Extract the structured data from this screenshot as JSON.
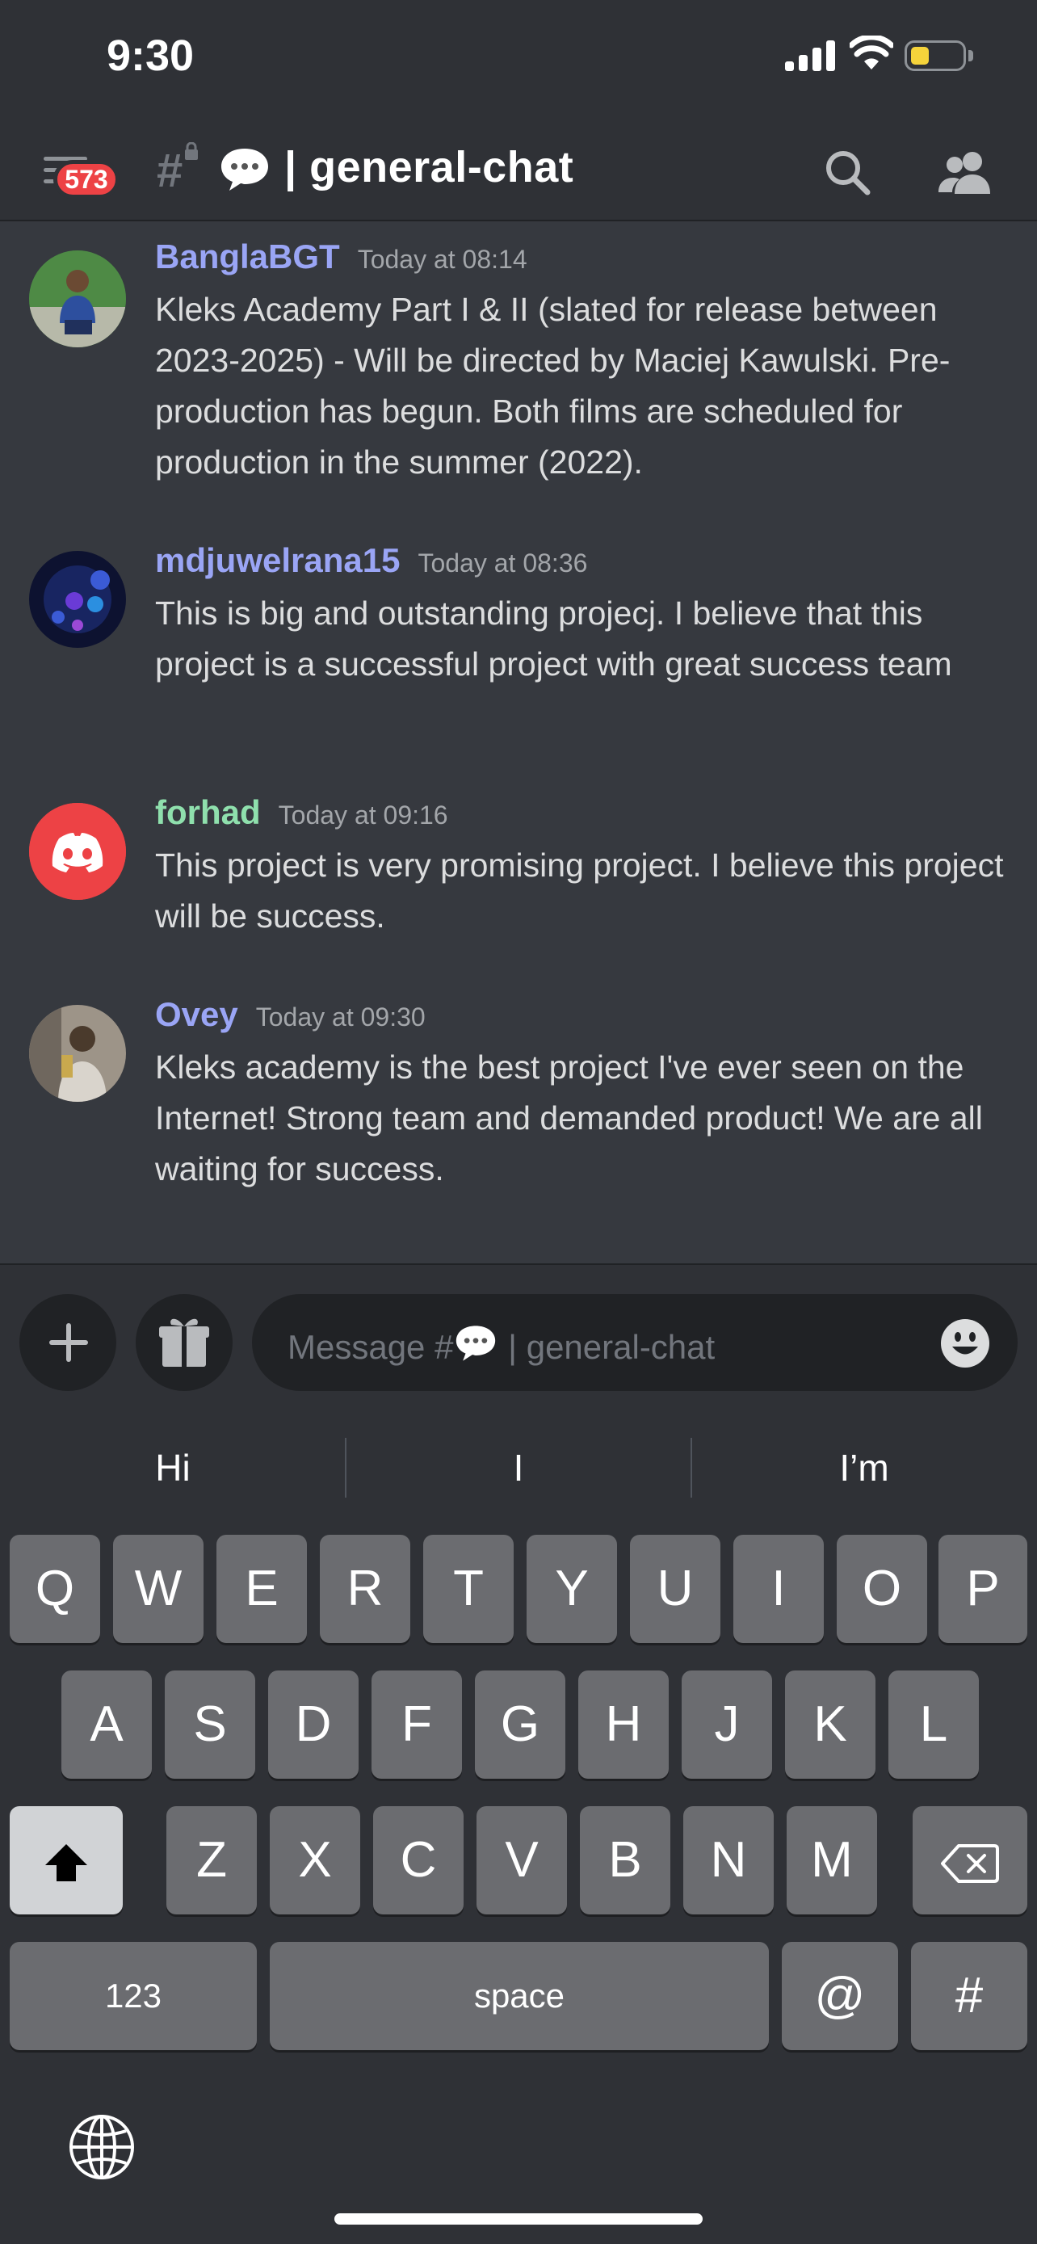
{
  "status_bar": {
    "time": "9:30"
  },
  "header": {
    "unread_badge": "573",
    "channel_name": "| general-chat",
    "icons": [
      "menu-icon",
      "hashtag-lock-icon",
      "speech-bubble-icon",
      "search-icon",
      "members-icon"
    ]
  },
  "messages": [
    {
      "username": "BanglaBGT",
      "username_color": "#9aa5f5",
      "timestamp": "Today at 08:14",
      "text": "Kleks Academy Part I & II (slated for release between 2023-2025) - Will be directed by Maciej Kawulski. Pre-production has begun. Both films are scheduled for production in the summer (2022)."
    },
    {
      "username": "mdjuwelrana15",
      "username_color": "#9aa5f5",
      "timestamp": "Today at 08:36",
      "text": "This is big and outstanding projecj. I believe that this project is a successful project with great success team"
    },
    {
      "username": "forhad",
      "username_color": "#8fe0ad",
      "timestamp": "Today at 09:16",
      "text": "This project is very promising project. I believe this project will be success."
    },
    {
      "username": "Ovey",
      "username_color": "#9aa5f5",
      "timestamp": "Today at 09:30",
      "text": "Kleks academy is the best project I've ever seen on the Internet! Strong team and demanded product! We are all waiting for success."
    }
  ],
  "composer": {
    "placeholder_prefix": "Message #",
    "placeholder_suffix": "| general-chat"
  },
  "suggestions": [
    "Hi",
    "I",
    "I’m"
  ],
  "keyboard": {
    "row1": [
      "Q",
      "W",
      "E",
      "R",
      "T",
      "Y",
      "U",
      "I",
      "O",
      "P"
    ],
    "row2": [
      "A",
      "S",
      "D",
      "F",
      "G",
      "H",
      "J",
      "K",
      "L"
    ],
    "row3": [
      "Z",
      "X",
      "C",
      "V",
      "B",
      "N",
      "M"
    ],
    "numbers_key": "123",
    "space_key": "space",
    "at_key": "@",
    "hash_key": "#"
  },
  "colors": {
    "background": "#36393f",
    "header": "#2f3136",
    "badge": "#ed4245",
    "blurple": "#5865f2"
  }
}
